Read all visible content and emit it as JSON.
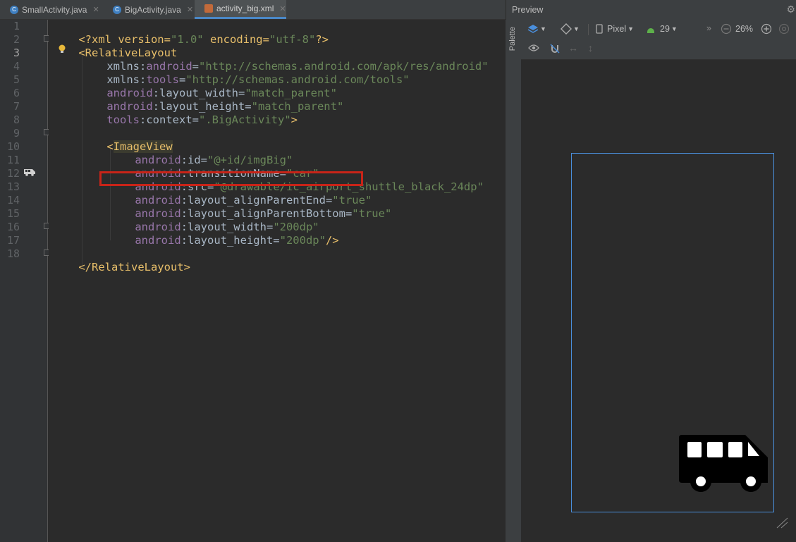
{
  "tabs": [
    {
      "label": "SmallActivity.java",
      "icon": "java-class-icon",
      "active": false
    },
    {
      "label": "BigActivity.java",
      "icon": "java-class-icon",
      "active": false
    },
    {
      "label": "activity_big.xml",
      "icon": "xml-layout-icon",
      "active": true
    }
  ],
  "editor": {
    "line_numbers": [
      "1",
      "2",
      "3",
      "4",
      "5",
      "6",
      "7",
      "8",
      "9",
      "10",
      "11",
      "12",
      "13",
      "14",
      "15",
      "16",
      "17",
      "18"
    ],
    "current_line": "3",
    "lines": {
      "l1": {
        "a": "<?xml version=",
        "b": "\"1.0\"",
        "c": " encoding=",
        "d": "\"utf-8\"",
        "e": "?>"
      },
      "l2": {
        "a": "<RelativeLayout"
      },
      "l3": {
        "a": "xmlns:",
        "b": "android",
        "c": "=",
        "d": "\"http://schemas.android.com/apk/res/android\""
      },
      "l4": {
        "a": "xmlns:",
        "b": "tools",
        "c": "=",
        "d": "\"http://schemas.android.com/tools\""
      },
      "l5": {
        "a": "android",
        "b": ":layout_width=",
        "c": "\"match_parent\""
      },
      "l6": {
        "a": "android",
        "b": ":layout_height=",
        "c": "\"match_parent\""
      },
      "l7": {
        "a": "tools",
        "b": ":context=",
        "c": "\".BigActivity\"",
        "d": ">"
      },
      "l9": {
        "a": "<",
        "b": "ImageView"
      },
      "l10": {
        "a": "android",
        "b": ":id=",
        "c": "\"@+id/imgBig\""
      },
      "l11": {
        "a": "android",
        "b": ":transitionName=",
        "c": "\"car\""
      },
      "l12": {
        "a": "android",
        "b": ":src=",
        "c": "\"@drawable/ic_airport_shuttle_black_24dp\""
      },
      "l13": {
        "a": "android",
        "b": ":layout_alignParentEnd=",
        "c": "\"true\""
      },
      "l14": {
        "a": "android",
        "b": ":layout_alignParentBottom=",
        "c": "\"true\""
      },
      "l15": {
        "a": "android",
        "b": ":layout_width=",
        "c": "\"200dp\""
      },
      "l16": {
        "a": "android",
        "b": ":layout_height=",
        "c": "\"200dp\"",
        "d": "/>"
      },
      "l18": {
        "a": "</RelativeLayout>"
      }
    }
  },
  "preview": {
    "title": "Preview",
    "palette_label": "Palette",
    "device": "Pixel",
    "api_level": "29",
    "zoom": "26%",
    "image_icon": "airport-shuttle-icon"
  },
  "colors": {
    "tag": "#e8bf6a",
    "namespace": "#9876aa",
    "value": "#6a8759",
    "highlight_box": "#c82418",
    "device_outline": "#4a8fdc"
  }
}
